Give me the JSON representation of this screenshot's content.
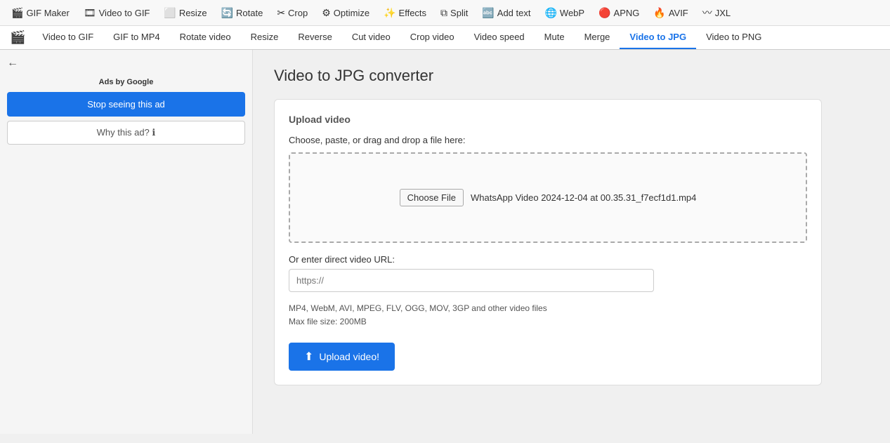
{
  "toolbar": {
    "items": [
      {
        "id": "gif-maker",
        "icon": "🎬",
        "label": "GIF Maker"
      },
      {
        "id": "video-to-gif",
        "icon": "🎞",
        "label": "Video to GIF"
      },
      {
        "id": "resize",
        "icon": "⬜",
        "label": "Resize"
      },
      {
        "id": "rotate",
        "icon": "🔄",
        "label": "Rotate"
      },
      {
        "id": "crop",
        "icon": "✂",
        "label": "Crop"
      },
      {
        "id": "optimize",
        "icon": "⚙",
        "label": "Optimize"
      },
      {
        "id": "effects",
        "icon": "✨",
        "label": "Effects"
      },
      {
        "id": "split",
        "icon": "⧉",
        "label": "Split"
      },
      {
        "id": "add-text",
        "icon": "🔤",
        "label": "Add text"
      },
      {
        "id": "webp",
        "icon": "🌐",
        "label": "WebP"
      },
      {
        "id": "apng",
        "icon": "🔴",
        "label": "APNG"
      },
      {
        "id": "avif",
        "icon": "🔥",
        "label": "AVIF"
      },
      {
        "id": "jxl",
        "icon": "〰",
        "label": "JXL"
      }
    ]
  },
  "nav": {
    "tabs": [
      {
        "id": "video-to-gif",
        "label": "Video to GIF"
      },
      {
        "id": "gif-to-mp4",
        "label": "GIF to MP4"
      },
      {
        "id": "rotate-video",
        "label": "Rotate video"
      },
      {
        "id": "resize",
        "label": "Resize"
      },
      {
        "id": "reverse",
        "label": "Reverse"
      },
      {
        "id": "cut-video",
        "label": "Cut video"
      },
      {
        "id": "crop-video",
        "label": "Crop video"
      },
      {
        "id": "video-speed",
        "label": "Video speed"
      },
      {
        "id": "mute",
        "label": "Mute"
      },
      {
        "id": "merge",
        "label": "Merge"
      },
      {
        "id": "video-to-jpg",
        "label": "Video to JPG",
        "active": true
      },
      {
        "id": "video-to-png",
        "label": "Video to PNG"
      }
    ]
  },
  "sidebar": {
    "ads_by": "Ads by",
    "google": "Google",
    "stop_ad_label": "Stop seeing this ad",
    "why_ad_label": "Why this ad? ℹ"
  },
  "main": {
    "page_title": "Video to JPG converter",
    "upload_section_title": "Upload video",
    "drag_drop_label": "Choose, paste, or drag and drop a file here:",
    "choose_file_btn": "Choose File",
    "file_name": "WhatsApp Video 2024-12-04 at 00.35.31_f7ecf1d1.mp4",
    "url_label": "Or enter direct video URL:",
    "url_placeholder": "https://",
    "file_formats": "MP4, WebM, AVI, MPEG, FLV, OGG, MOV, 3GP and other video files",
    "max_file_size": "Max file size: 200MB",
    "upload_btn_label": "Upload video!"
  }
}
